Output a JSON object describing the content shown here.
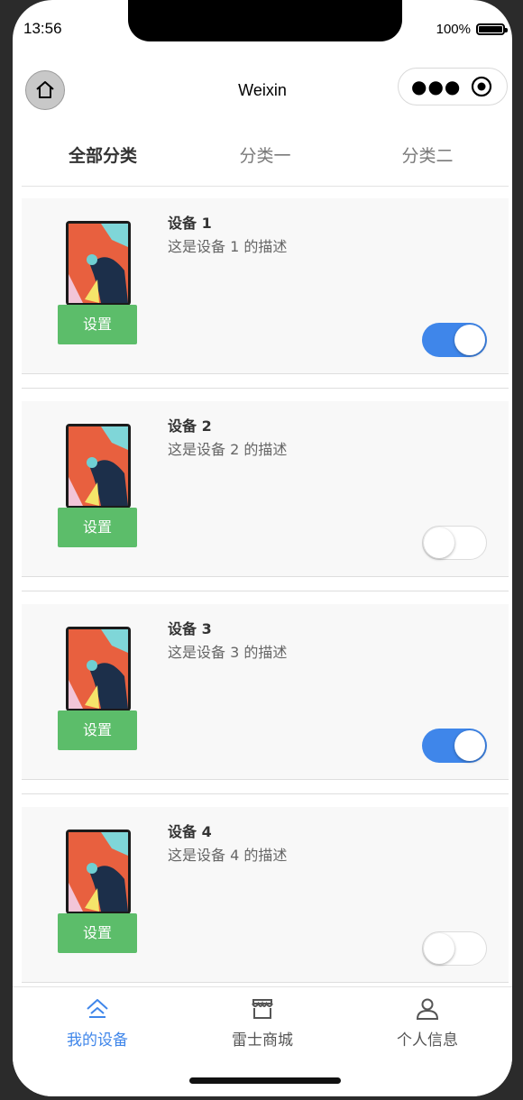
{
  "status_bar": {
    "time": "13:56",
    "battery": "100%"
  },
  "navbar": {
    "title": "Weixin"
  },
  "tabs": [
    {
      "label": "全部分类",
      "active": true
    },
    {
      "label": "分类一",
      "active": false
    },
    {
      "label": "分类二",
      "active": false
    }
  ],
  "devices": [
    {
      "name": "设备 1",
      "desc": "这是设备 1 的描述",
      "button": "设置",
      "on": true
    },
    {
      "name": "设备 2",
      "desc": "这是设备 2 的描述",
      "button": "设置",
      "on": false
    },
    {
      "name": "设备 3",
      "desc": "这是设备 3 的描述",
      "button": "设置",
      "on": true
    },
    {
      "name": "设备 4",
      "desc": "这是设备 4 的描述",
      "button": "设置",
      "on": false
    }
  ],
  "tabbar": [
    {
      "label": "我的设备",
      "icon": "home-icon",
      "active": true
    },
    {
      "label": "雷士商城",
      "icon": "store-icon",
      "active": false
    },
    {
      "label": "个人信息",
      "icon": "user-icon",
      "active": false
    }
  ],
  "colors": {
    "accent": "#3f86ea",
    "button_green": "#5cbd6a"
  }
}
